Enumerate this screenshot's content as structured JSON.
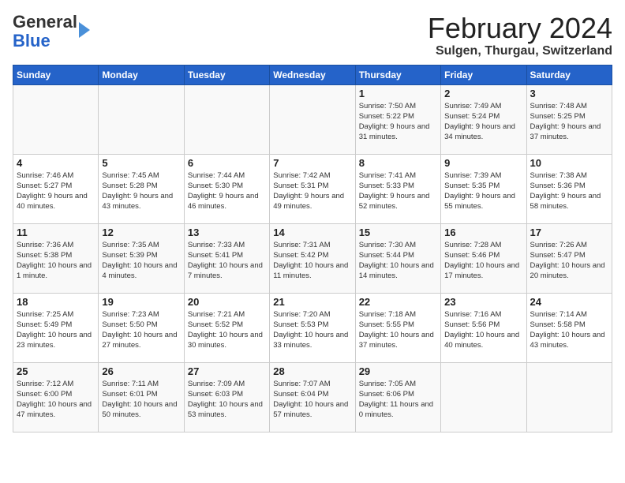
{
  "header": {
    "logo_general": "General",
    "logo_blue": "Blue",
    "title": "February 2024",
    "subtitle": "Sulgen, Thurgau, Switzerland"
  },
  "calendar": {
    "days_of_week": [
      "Sunday",
      "Monday",
      "Tuesday",
      "Wednesday",
      "Thursday",
      "Friday",
      "Saturday"
    ],
    "weeks": [
      [
        {
          "day": "",
          "info": ""
        },
        {
          "day": "",
          "info": ""
        },
        {
          "day": "",
          "info": ""
        },
        {
          "day": "",
          "info": ""
        },
        {
          "day": "1",
          "info": "Sunrise: 7:50 AM\nSunset: 5:22 PM\nDaylight: 9 hours and 31 minutes."
        },
        {
          "day": "2",
          "info": "Sunrise: 7:49 AM\nSunset: 5:24 PM\nDaylight: 9 hours and 34 minutes."
        },
        {
          "day": "3",
          "info": "Sunrise: 7:48 AM\nSunset: 5:25 PM\nDaylight: 9 hours and 37 minutes."
        }
      ],
      [
        {
          "day": "4",
          "info": "Sunrise: 7:46 AM\nSunset: 5:27 PM\nDaylight: 9 hours and 40 minutes."
        },
        {
          "day": "5",
          "info": "Sunrise: 7:45 AM\nSunset: 5:28 PM\nDaylight: 9 hours and 43 minutes."
        },
        {
          "day": "6",
          "info": "Sunrise: 7:44 AM\nSunset: 5:30 PM\nDaylight: 9 hours and 46 minutes."
        },
        {
          "day": "7",
          "info": "Sunrise: 7:42 AM\nSunset: 5:31 PM\nDaylight: 9 hours and 49 minutes."
        },
        {
          "day": "8",
          "info": "Sunrise: 7:41 AM\nSunset: 5:33 PM\nDaylight: 9 hours and 52 minutes."
        },
        {
          "day": "9",
          "info": "Sunrise: 7:39 AM\nSunset: 5:35 PM\nDaylight: 9 hours and 55 minutes."
        },
        {
          "day": "10",
          "info": "Sunrise: 7:38 AM\nSunset: 5:36 PM\nDaylight: 9 hours and 58 minutes."
        }
      ],
      [
        {
          "day": "11",
          "info": "Sunrise: 7:36 AM\nSunset: 5:38 PM\nDaylight: 10 hours and 1 minute."
        },
        {
          "day": "12",
          "info": "Sunrise: 7:35 AM\nSunset: 5:39 PM\nDaylight: 10 hours and 4 minutes."
        },
        {
          "day": "13",
          "info": "Sunrise: 7:33 AM\nSunset: 5:41 PM\nDaylight: 10 hours and 7 minutes."
        },
        {
          "day": "14",
          "info": "Sunrise: 7:31 AM\nSunset: 5:42 PM\nDaylight: 10 hours and 11 minutes."
        },
        {
          "day": "15",
          "info": "Sunrise: 7:30 AM\nSunset: 5:44 PM\nDaylight: 10 hours and 14 minutes."
        },
        {
          "day": "16",
          "info": "Sunrise: 7:28 AM\nSunset: 5:46 PM\nDaylight: 10 hours and 17 minutes."
        },
        {
          "day": "17",
          "info": "Sunrise: 7:26 AM\nSunset: 5:47 PM\nDaylight: 10 hours and 20 minutes."
        }
      ],
      [
        {
          "day": "18",
          "info": "Sunrise: 7:25 AM\nSunset: 5:49 PM\nDaylight: 10 hours and 23 minutes."
        },
        {
          "day": "19",
          "info": "Sunrise: 7:23 AM\nSunset: 5:50 PM\nDaylight: 10 hours and 27 minutes."
        },
        {
          "day": "20",
          "info": "Sunrise: 7:21 AM\nSunset: 5:52 PM\nDaylight: 10 hours and 30 minutes."
        },
        {
          "day": "21",
          "info": "Sunrise: 7:20 AM\nSunset: 5:53 PM\nDaylight: 10 hours and 33 minutes."
        },
        {
          "day": "22",
          "info": "Sunrise: 7:18 AM\nSunset: 5:55 PM\nDaylight: 10 hours and 37 minutes."
        },
        {
          "day": "23",
          "info": "Sunrise: 7:16 AM\nSunset: 5:56 PM\nDaylight: 10 hours and 40 minutes."
        },
        {
          "day": "24",
          "info": "Sunrise: 7:14 AM\nSunset: 5:58 PM\nDaylight: 10 hours and 43 minutes."
        }
      ],
      [
        {
          "day": "25",
          "info": "Sunrise: 7:12 AM\nSunset: 6:00 PM\nDaylight: 10 hours and 47 minutes."
        },
        {
          "day": "26",
          "info": "Sunrise: 7:11 AM\nSunset: 6:01 PM\nDaylight: 10 hours and 50 minutes."
        },
        {
          "day": "27",
          "info": "Sunrise: 7:09 AM\nSunset: 6:03 PM\nDaylight: 10 hours and 53 minutes."
        },
        {
          "day": "28",
          "info": "Sunrise: 7:07 AM\nSunset: 6:04 PM\nDaylight: 10 hours and 57 minutes."
        },
        {
          "day": "29",
          "info": "Sunrise: 7:05 AM\nSunset: 6:06 PM\nDaylight: 11 hours and 0 minutes."
        },
        {
          "day": "",
          "info": ""
        },
        {
          "day": "",
          "info": ""
        }
      ]
    ]
  }
}
